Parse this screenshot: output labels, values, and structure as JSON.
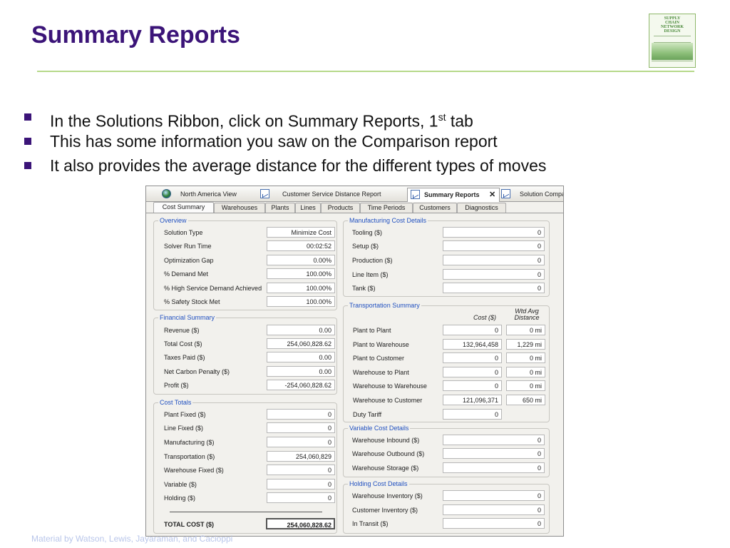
{
  "slide": {
    "title": "Summary Reports",
    "bullets": [
      {
        "pre": "In the Solutions Ribbon, click on Summary Reports, 1",
        "sup": "st",
        "post": " tab"
      },
      {
        "pre": "This has some information you saw on the Comparison report",
        "sup": "",
        "post": ""
      },
      {
        "pre": "It also provides the average distance for the different types of moves",
        "sup": "",
        "post": ""
      }
    ],
    "footer": "Material by Watson, Lewis, Jayaraman, and Cacioppi",
    "book_cover_title": "SUPPLY\nCHAIN\nNETWORK\nDESIGN"
  },
  "doc_tabs": [
    {
      "label": "North America View",
      "icon": "globe-icon"
    },
    {
      "label": "Customer Service Distance Report",
      "icon": "chart-icon"
    },
    {
      "label": "Summary Reports",
      "icon": "chart-icon",
      "active": true,
      "close": "✕"
    },
    {
      "label": "Solution Compa",
      "icon": "chart-icon"
    }
  ],
  "sub_tabs": [
    "Cost Summary",
    "Warehouses",
    "Plants",
    "Lines",
    "Products",
    "Time Periods",
    "Customers",
    "Diagnostics"
  ],
  "active_sub_tab": "Cost Summary",
  "overview": {
    "title": "Overview",
    "rows": [
      {
        "label": "Solution Type",
        "value": "Minimize Cost"
      },
      {
        "label": "Solver Run Time",
        "value": "00:02:52"
      },
      {
        "label": "Optimization Gap",
        "value": "0.00%"
      },
      {
        "label": "% Demand Met",
        "value": "100.00%"
      },
      {
        "label": "% High Service Demand Achieved",
        "value": "100.00%"
      },
      {
        "label": "% Safety Stock Met",
        "value": "100.00%"
      }
    ]
  },
  "financial": {
    "title": "Financial Summary",
    "rows": [
      {
        "label": "Revenue ($)",
        "value": "0.00"
      },
      {
        "label": "Total Cost ($)",
        "value": "254,060,828.62"
      },
      {
        "label": "Taxes Paid ($)",
        "value": "0.00"
      },
      {
        "label": "Net Carbon Penalty ($)",
        "value": "0.00"
      },
      {
        "label": "Profit ($)",
        "value": "-254,060,828.62"
      }
    ]
  },
  "cost_totals": {
    "title": "Cost Totals",
    "rows": [
      {
        "label": "Plant Fixed ($)",
        "value": "0"
      },
      {
        "label": "Line Fixed ($)",
        "value": "0"
      },
      {
        "label": "Manufacturing ($)",
        "value": "0"
      },
      {
        "label": "Transportation ($)",
        "value": "254,060,829"
      },
      {
        "label": "Warehouse Fixed ($)",
        "value": "0"
      },
      {
        "label": "Variable ($)",
        "value": "0"
      },
      {
        "label": "Holding ($)",
        "value": "0"
      }
    ],
    "total_label": "TOTAL COST ($)",
    "total_value": "254,060,828.62"
  },
  "manufacturing": {
    "title": "Manufacturing Cost Details",
    "rows": [
      {
        "label": "Tooling ($)",
        "value": "0"
      },
      {
        "label": "Setup ($)",
        "value": "0"
      },
      {
        "label": "Production ($)",
        "value": "0"
      },
      {
        "label": "Line Item ($)",
        "value": "0"
      },
      {
        "label": "Tank ($)",
        "value": "0"
      }
    ]
  },
  "transportation": {
    "title": "Transportation Summary",
    "col_cost": "Cost ($)",
    "col_dist": "Wtd Avg Distance",
    "rows": [
      {
        "label": "Plant to Plant",
        "cost": "0",
        "dist": "0 mi"
      },
      {
        "label": "Plant to Warehouse",
        "cost": "132,964,458",
        "dist": "1,229 mi"
      },
      {
        "label": "Plant to Customer",
        "cost": "0",
        "dist": "0 mi"
      },
      {
        "label": "Warehouse to Plant",
        "cost": "0",
        "dist": "0 mi"
      },
      {
        "label": "Warehouse to Warehouse",
        "cost": "0",
        "dist": "0 mi"
      },
      {
        "label": "Warehouse to Customer",
        "cost": "121,096,371",
        "dist": "650 mi"
      },
      {
        "label": "Duty Tariff",
        "cost": "0",
        "dist": null
      }
    ]
  },
  "variable": {
    "title": "Variable Cost Details",
    "rows": [
      {
        "label": "Warehouse Inbound ($)",
        "value": "0"
      },
      {
        "label": "Warehouse Outbound ($)",
        "value": "0"
      },
      {
        "label": "Warehouse Storage ($)",
        "value": "0"
      }
    ]
  },
  "holding": {
    "title": "Holding Cost Details",
    "rows": [
      {
        "label": "Warehouse Inventory ($)",
        "value": "0"
      },
      {
        "label": "Customer Inventory ($)",
        "value": "0"
      },
      {
        "label": "In Transit ($)",
        "value": "0"
      }
    ]
  },
  "colors": {
    "title": "#3b1478",
    "group_title": "#2050c0",
    "rule": "#b6d98a"
  }
}
